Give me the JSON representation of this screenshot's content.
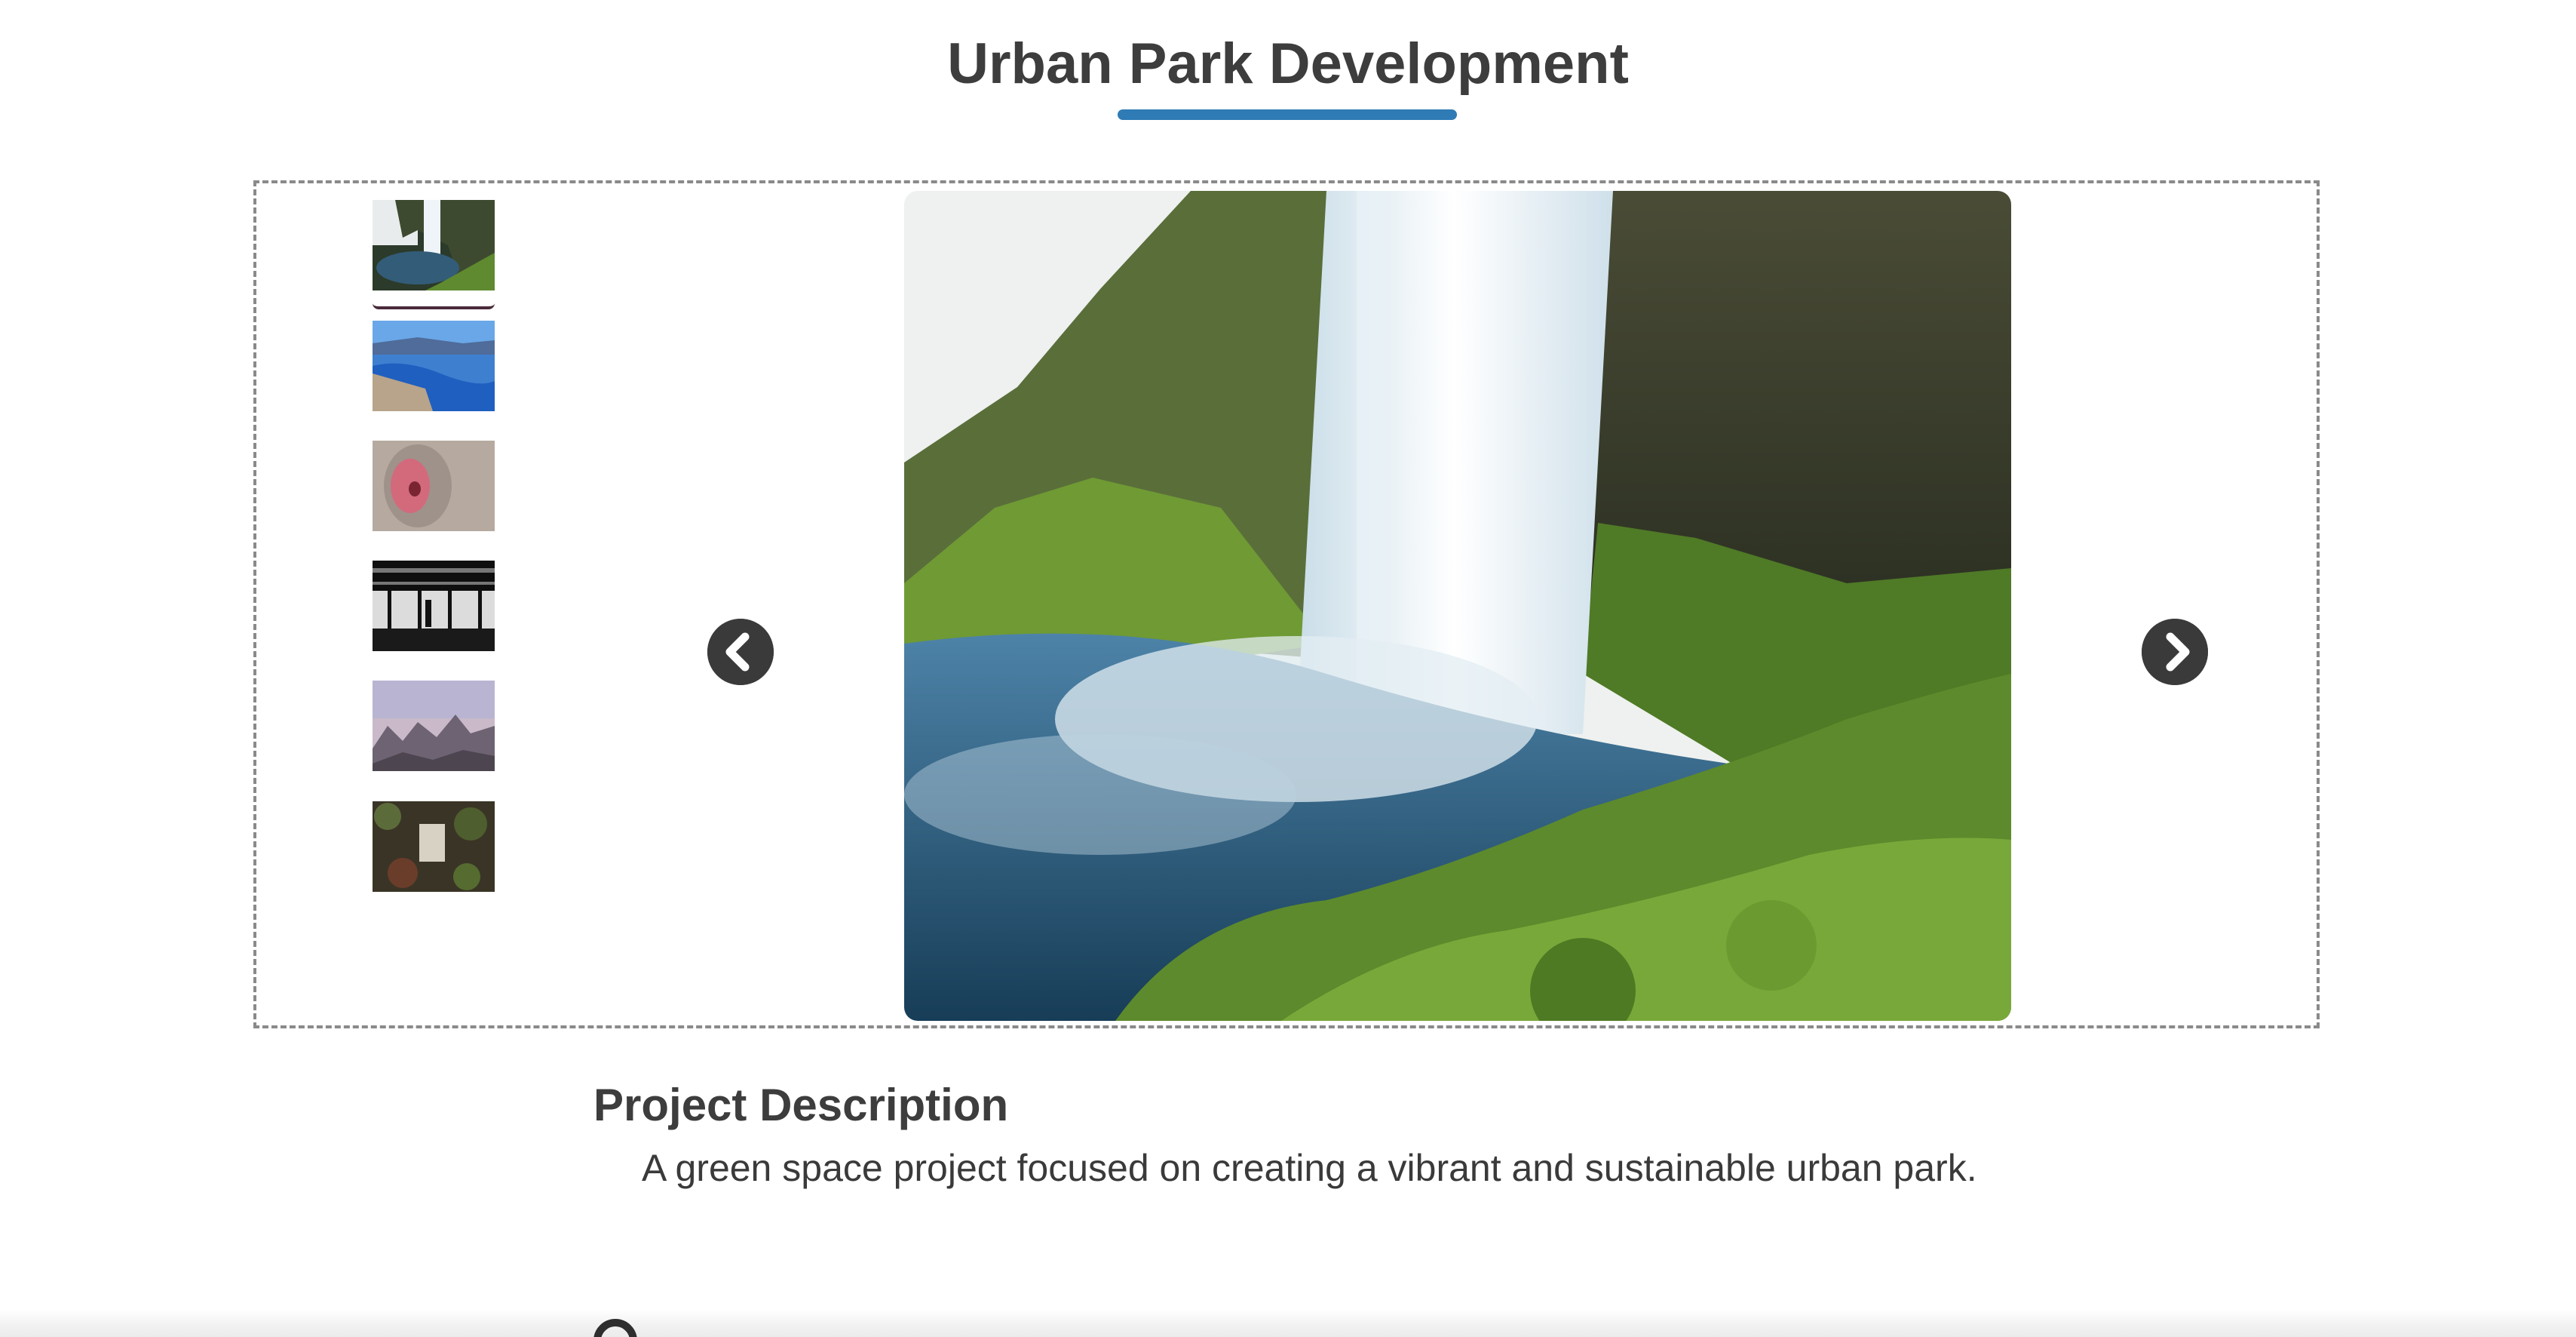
{
  "page": {
    "title": "Urban Park Development",
    "accent_color": "#2f7bb6"
  },
  "gallery": {
    "thumbnails": [
      {
        "subject": "waterfall",
        "selected": true
      },
      {
        "subject": "fjord-lake"
      },
      {
        "subject": "monkey-face"
      },
      {
        "subject": "person-in-station"
      },
      {
        "subject": "mountain-peaks"
      },
      {
        "subject": "forest-floor"
      }
    ],
    "main_image_subject": "waterfall",
    "prev_icon": "chevron-left-circle-icon",
    "next_icon": "chevron-right-circle-icon"
  },
  "description": {
    "heading": "Project Description",
    "text": "A green space project focused on creating a vibrant and sustainable urban park."
  }
}
